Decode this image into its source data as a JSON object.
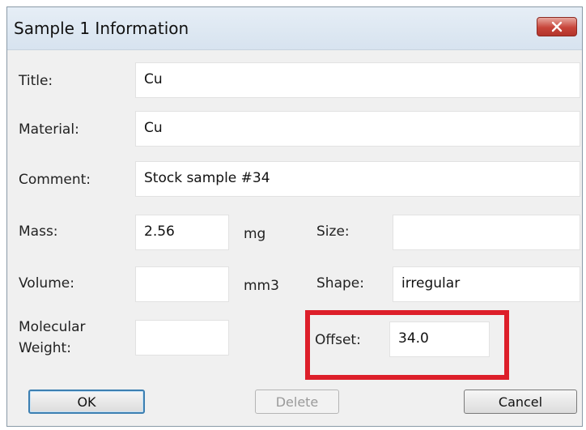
{
  "window": {
    "title": "Sample 1 Information"
  },
  "fields": {
    "title": {
      "label": "Title:",
      "value": "Cu"
    },
    "material": {
      "label": "Material:",
      "value": "Cu"
    },
    "comment": {
      "label": "Comment:",
      "value": "Stock sample #34"
    },
    "mass": {
      "label": "Mass:",
      "value": "2.56",
      "unit": "mg"
    },
    "size": {
      "label": "Size:",
      "value": ""
    },
    "volume": {
      "label": "Volume:",
      "value": "",
      "unit": "mm3"
    },
    "shape": {
      "label": "Shape:",
      "value": "irregular"
    },
    "molecular_weight": {
      "label_line1": "Molecular",
      "label_line2": "Weight:",
      "value": ""
    },
    "offset": {
      "label": "Offset:",
      "value": "34.0"
    }
  },
  "buttons": {
    "ok": "OK",
    "delete": "Delete",
    "cancel": "Cancel"
  },
  "colors": {
    "highlight": "#dd1f2a",
    "close_button": "#c7453a"
  }
}
